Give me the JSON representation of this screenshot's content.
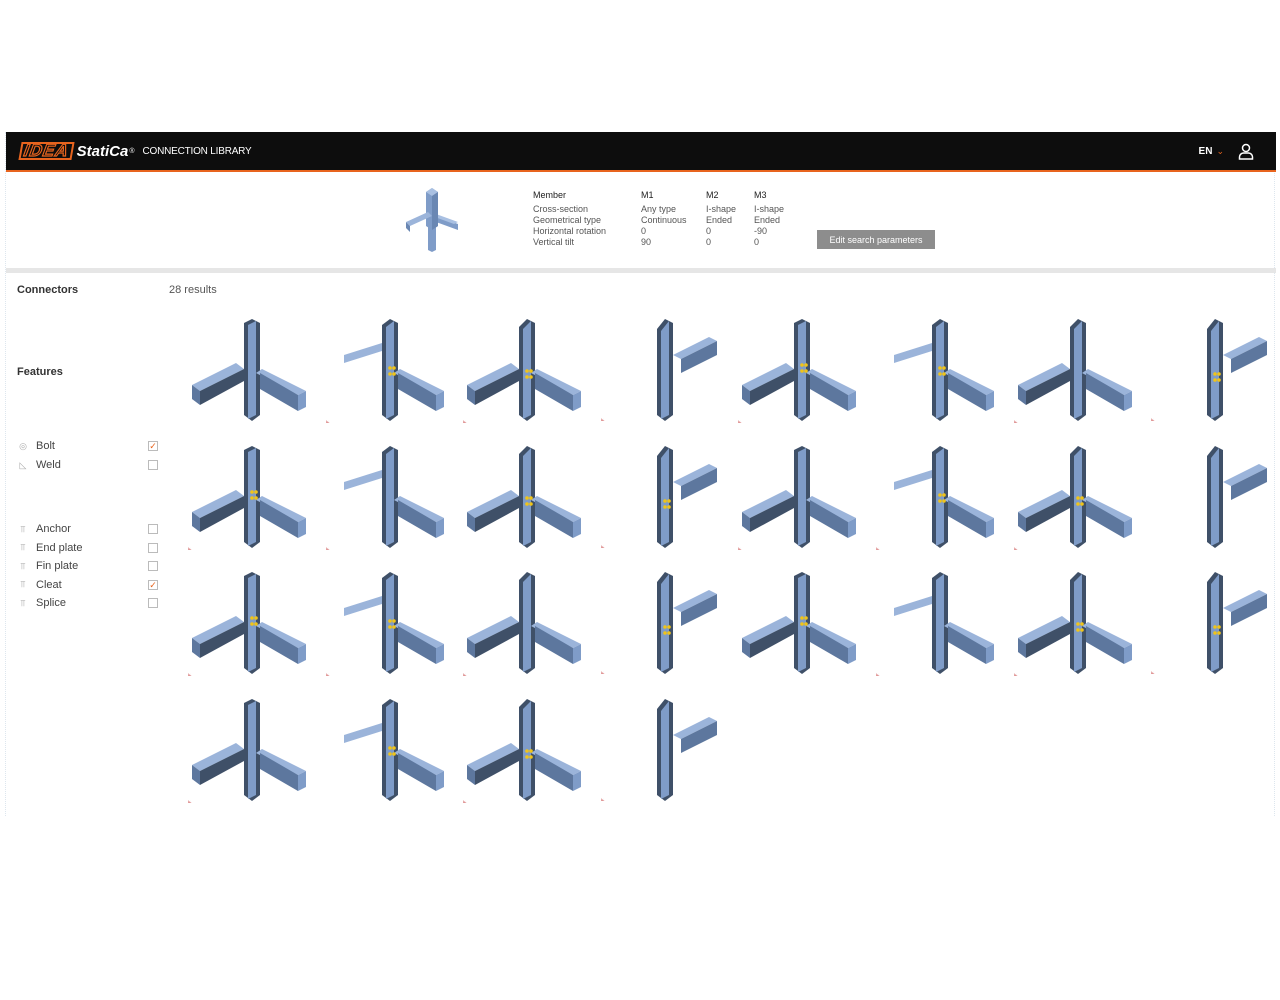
{
  "header": {
    "logo_text": "IDEA StatiCa",
    "app_name": "CONNECTION LIBRARY",
    "language": "EN",
    "accent_color": "#e8641e",
    "user_icon": "user-icon"
  },
  "search": {
    "headers": [
      "Member",
      "M1",
      "M2",
      "M3"
    ],
    "rows": [
      [
        "Cross-section",
        "Any type",
        "I-shape",
        "I-shape"
      ],
      [
        "Geometrical type",
        "Continuous",
        "Ended",
        "Ended"
      ],
      [
        "Horizontal rotation",
        "0",
        "0",
        "-90"
      ],
      [
        "Vertical tilt",
        "90",
        "0",
        "0"
      ]
    ],
    "edit_label": "Edit search parameters"
  },
  "sidebar": {
    "connectors_title": "Connectors",
    "connectors": [
      {
        "label": "Bolt",
        "icon": "bolt-icon",
        "checked": true
      },
      {
        "label": "Weld",
        "icon": "weld-icon",
        "checked": false
      }
    ],
    "features_title": "Features",
    "features": [
      {
        "label": "Anchor",
        "icon": "member-icon",
        "checked": false
      },
      {
        "label": "End plate",
        "icon": "member-icon",
        "checked": false
      },
      {
        "label": "Fin plate",
        "icon": "member-icon",
        "checked": false
      },
      {
        "label": "Cleat",
        "icon": "member-icon",
        "checked": true
      },
      {
        "label": "Splice",
        "icon": "member-icon",
        "checked": false
      }
    ]
  },
  "results": {
    "count_label": "28 results",
    "steel_color": "#7f9cc8"
  }
}
